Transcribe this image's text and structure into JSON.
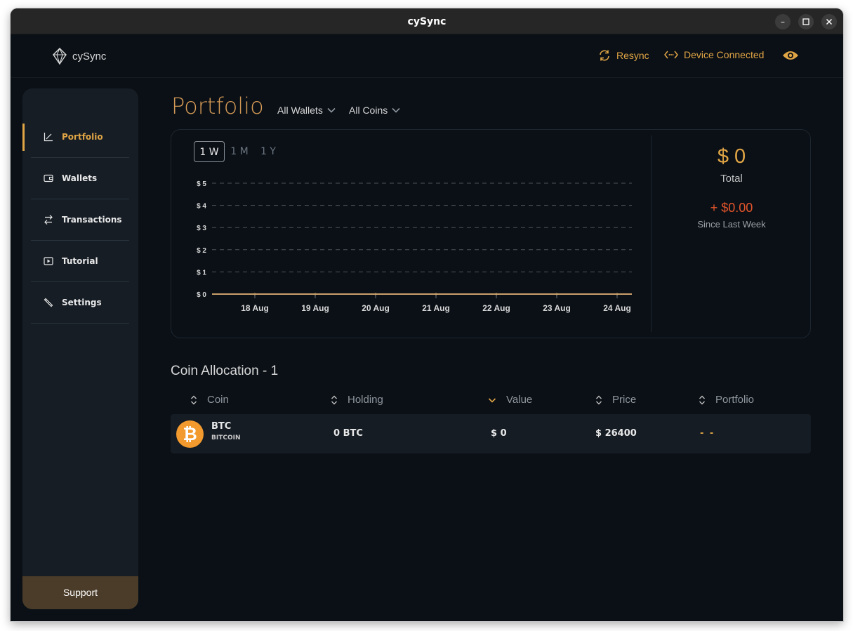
{
  "window": {
    "title": "cySync"
  },
  "header": {
    "brand": "cySync",
    "resync_label": "Resync",
    "device_label": "Device Connected"
  },
  "sidebar": {
    "items": [
      {
        "label": "Portfolio",
        "icon": "chart-icon",
        "active": true
      },
      {
        "label": "Wallets",
        "icon": "wallet-icon",
        "active": false
      },
      {
        "label": "Transactions",
        "icon": "transfer-icon",
        "active": false
      },
      {
        "label": "Tutorial",
        "icon": "play-icon",
        "active": false
      },
      {
        "label": "Settings",
        "icon": "wrench-icon",
        "active": false
      }
    ],
    "support_label": "Support"
  },
  "page": {
    "title": "Portfolio",
    "wallet_filter": "All Wallets",
    "coin_filter": "All Coins"
  },
  "chart": {
    "ranges": [
      "1 W",
      "1 M",
      "1 Y"
    ],
    "active_range": "1 W",
    "total_value": "$ 0",
    "total_label": "Total",
    "change_value": "+ $0.00",
    "change_label": "Since Last Week"
  },
  "chart_data": {
    "type": "line",
    "x": [
      "18 Aug",
      "19 Aug",
      "20 Aug",
      "21 Aug",
      "22 Aug",
      "23 Aug",
      "24 Aug"
    ],
    "series": [
      {
        "values": [
          0,
          0,
          0,
          0,
          0,
          0,
          0
        ]
      }
    ],
    "y_ticks": [
      "$ 0",
      "$ 1",
      "$ 2",
      "$ 3",
      "$ 4",
      "$ 5"
    ],
    "ylim": [
      0,
      5
    ],
    "grid": true
  },
  "allocation": {
    "title": "Coin Allocation - 1",
    "columns": [
      "Coin",
      "Holding",
      "Value",
      "Price",
      "Portfolio"
    ],
    "rows": [
      {
        "symbol": "BTC",
        "name": "BITCOIN",
        "holding": "0 BTC",
        "value": "$ 0",
        "price": "$ 26400",
        "portfolio": "- -"
      }
    ]
  },
  "colors": {
    "accent": "#e0a545",
    "negative": "#e5552b",
    "background": "#0b1016",
    "sidebar": "#161d25",
    "bitcoin": "#f39a2e"
  }
}
